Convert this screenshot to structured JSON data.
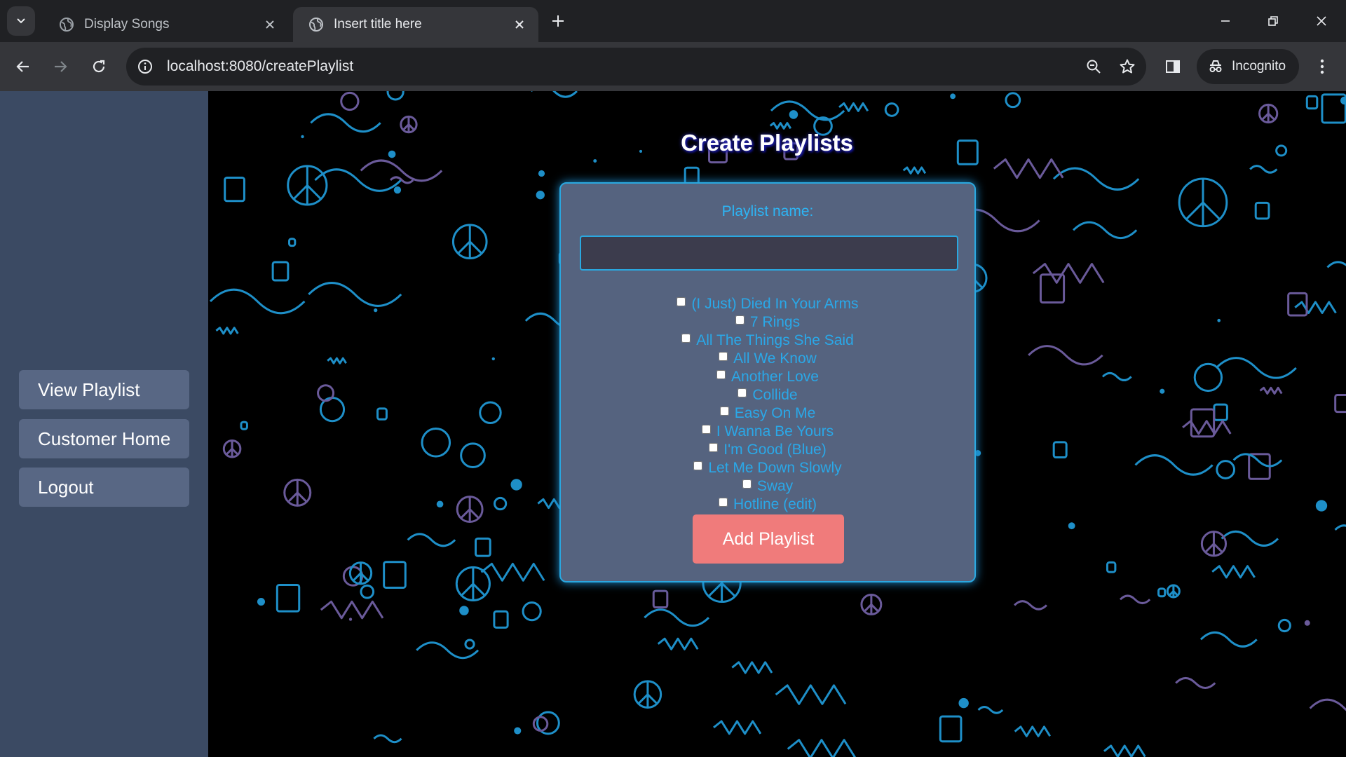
{
  "browser": {
    "tabs": [
      {
        "title": "Display Songs",
        "active": false
      },
      {
        "title": "Insert title here",
        "active": true
      }
    ],
    "url": "localhost:8080/createPlaylist",
    "profile_label": "Incognito"
  },
  "sidebar": {
    "items": [
      {
        "label": "View Playlist"
      },
      {
        "label": "Customer Home"
      },
      {
        "label": "Logout"
      }
    ]
  },
  "main": {
    "heading": "Create Playlists",
    "form": {
      "name_label": "Playlist name:",
      "name_value": "",
      "songs": [
        {
          "title": "(I Just) Died In Your Arms",
          "checked": false
        },
        {
          "title": "7 Rings",
          "checked": false
        },
        {
          "title": "All The Things She Said",
          "checked": false
        },
        {
          "title": "All We Know",
          "checked": false
        },
        {
          "title": "Another Love",
          "checked": false
        },
        {
          "title": "Collide",
          "checked": false
        },
        {
          "title": "Easy On Me",
          "checked": false
        },
        {
          "title": "I Wanna Be Yours",
          "checked": false
        },
        {
          "title": "I'm Good (Blue)",
          "checked": false
        },
        {
          "title": "Let Me Down Slowly",
          "checked": false
        },
        {
          "title": "Sway",
          "checked": false
        },
        {
          "title": "Hotline (edit)",
          "checked": false
        }
      ],
      "submit_label": "Add Playlist"
    }
  },
  "colors": {
    "sidebar_bg": "#3b4a63",
    "sidebar_button": "#586784",
    "card_bg": "#55637f",
    "accent_blue": "#2aa8e8",
    "button_red": "#f07b7b",
    "doodle_cyan": "#1e8fc8",
    "doodle_purple": "#6a5a9a"
  }
}
